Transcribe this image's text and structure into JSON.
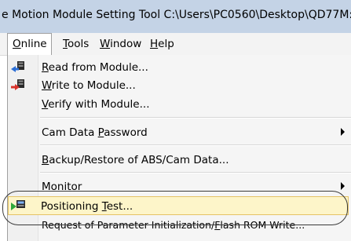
{
  "window": {
    "title": "e Motion Module Setting Tool C:\\Users\\PC0560\\Desktop\\QD77M:"
  },
  "menubar": {
    "items": [
      {
        "label": "Online",
        "mnemonic": "O",
        "rest": "nline"
      },
      {
        "label": "Tools",
        "mnemonic": "T",
        "rest": "ools"
      },
      {
        "label": "Window",
        "mnemonic": "W",
        "rest": "indow"
      },
      {
        "label": "Help",
        "mnemonic": "H",
        "rest": "elp"
      }
    ]
  },
  "online_menu": {
    "read": {
      "pre": "",
      "mn": "R",
      "post": "ead from Module...",
      "icon": "read-from-module-icon"
    },
    "write": {
      "pre": "",
      "mn": "W",
      "post": "rite to Module...",
      "icon": "write-to-module-icon"
    },
    "verify": {
      "pre": "",
      "mn": "V",
      "post": "erify with Module..."
    },
    "cam_password": {
      "pre": "Cam Data ",
      "mn": "P",
      "post": "assword",
      "has_submenu": true
    },
    "backup": {
      "pre": "",
      "mn": "B",
      "post": "ackup/Restore of ABS/Cam Data..."
    },
    "monitor": {
      "pre": "",
      "mn": "M",
      "post": "onitor",
      "has_submenu": true
    },
    "positioning_test": {
      "pre": "Positioning ",
      "mn": "T",
      "post": "est...",
      "icon": "positioning-test-icon"
    },
    "param_init": {
      "pre": "Request of Parameter Initialization/",
      "mn": "F",
      "post": "lash ROM Write..."
    }
  },
  "colors": {
    "titlebar": "#c4d3e6",
    "highlight_bg": "#fdf5c9",
    "highlight_border": "#e5c365"
  }
}
